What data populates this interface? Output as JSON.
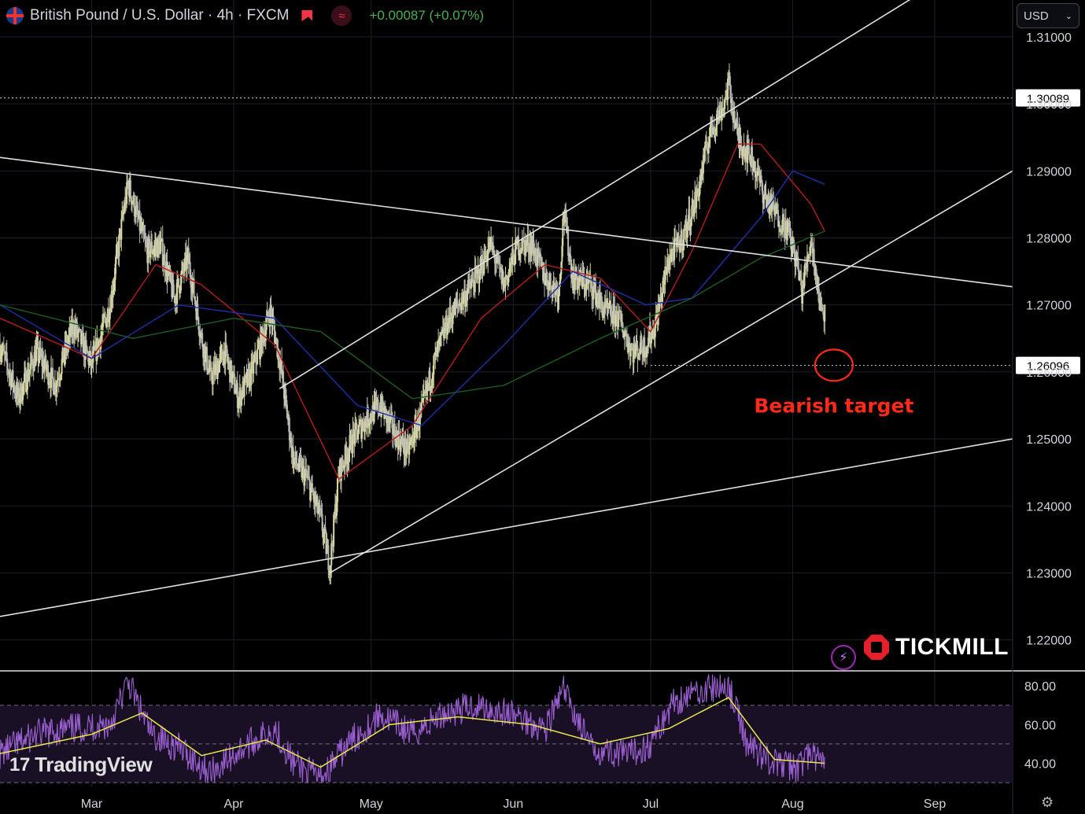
{
  "header": {
    "symbol": "British Pound / U.S. Dollar · 4h · FXCM",
    "change": "+0.00087 (+0.07%)"
  },
  "currency_selector": {
    "label": "USD"
  },
  "branding": {
    "tradingview": "TradingView",
    "tickmill": "TICKMILL"
  },
  "colors": {
    "background": "#000000",
    "candle_up": "#d8d8a0",
    "candle_down": "#b8b8b8",
    "ema_fast": "#b71c1c",
    "ema_mid": "#1e2fa8",
    "ema_slow": "#1b5e20",
    "trendline": "#e0e0e0",
    "rsi": "#9a5fd0",
    "rsi_ma": "#e8e84a",
    "annotation": "#ff2a1a",
    "change_positive": "#4caf50"
  },
  "chart_data": {
    "type": "candlestick",
    "instrument": "GBPUSD",
    "timeframe": "4h",
    "x_axis": {
      "range": [
        "2024-02-10",
        "2024-09-18"
      ],
      "ticks": [
        {
          "date": "2024-03-01",
          "label": "Mar"
        },
        {
          "date": "2024-04-01",
          "label": "Apr"
        },
        {
          "date": "2024-05-01",
          "label": "May"
        },
        {
          "date": "2024-06-01",
          "label": "Jun"
        },
        {
          "date": "2024-07-01",
          "label": "Jul"
        },
        {
          "date": "2024-08-01",
          "label": "Aug"
        },
        {
          "date": "2024-09-01",
          "label": "Sep"
        }
      ]
    },
    "y_axis": {
      "range": [
        1.2155,
        1.3155
      ],
      "ticks": [
        "1.22000",
        "1.23000",
        "1.24000",
        "1.25000",
        "1.26000",
        "1.27000",
        "1.28000",
        "1.29000",
        "1.30000",
        "1.31000"
      ]
    },
    "price_path": [
      [
        "2024-02-10",
        1.264
      ],
      [
        "2024-02-14",
        1.256
      ],
      [
        "2024-02-18",
        1.263
      ],
      [
        "2024-02-22",
        1.258
      ],
      [
        "2024-02-26",
        1.267
      ],
      [
        "2024-03-01",
        1.261
      ],
      [
        "2024-03-05",
        1.27
      ],
      [
        "2024-03-08",
        1.284
      ],
      [
        "2024-03-09",
        1.288
      ],
      [
        "2024-03-13",
        1.278
      ],
      [
        "2024-03-16",
        1.279
      ],
      [
        "2024-03-19",
        1.271
      ],
      [
        "2024-03-22",
        1.277
      ],
      [
        "2024-03-25",
        1.265
      ],
      [
        "2024-03-27",
        1.259
      ],
      [
        "2024-03-30",
        1.263
      ],
      [
        "2024-04-02",
        1.256
      ],
      [
        "2024-04-05",
        1.26
      ],
      [
        "2024-04-09",
        1.269
      ],
      [
        "2024-04-11",
        1.262
      ],
      [
        "2024-04-14",
        1.247
      ],
      [
        "2024-04-17",
        1.244
      ],
      [
        "2024-04-20",
        1.238
      ],
      [
        "2024-04-22",
        1.231
      ],
      [
        "2024-04-24",
        1.245
      ],
      [
        "2024-04-27",
        1.25
      ],
      [
        "2024-04-30",
        1.253
      ],
      [
        "2024-05-03",
        1.255
      ],
      [
        "2024-05-06",
        1.251
      ],
      [
        "2024-05-09",
        1.248
      ],
      [
        "2024-05-12",
        1.254
      ],
      [
        "2024-05-15",
        1.262
      ],
      [
        "2024-05-18",
        1.268
      ],
      [
        "2024-05-21",
        1.271
      ],
      [
        "2024-05-24",
        1.274
      ],
      [
        "2024-05-27",
        1.279
      ],
      [
        "2024-05-30",
        1.273
      ],
      [
        "2024-06-02",
        1.279
      ],
      [
        "2024-06-05",
        1.279
      ],
      [
        "2024-06-08",
        1.274
      ],
      [
        "2024-06-11",
        1.272
      ],
      [
        "2024-06-12",
        1.284
      ],
      [
        "2024-06-14",
        1.274
      ],
      [
        "2024-06-18",
        1.273
      ],
      [
        "2024-06-21",
        1.269
      ],
      [
        "2024-06-24",
        1.268
      ],
      [
        "2024-06-27",
        1.263
      ],
      [
        "2024-06-30",
        1.264
      ],
      [
        "2024-07-02",
        1.267
      ],
      [
        "2024-07-05",
        1.277
      ],
      [
        "2024-07-08",
        1.28
      ],
      [
        "2024-07-11",
        1.286
      ],
      [
        "2024-07-14",
        1.296
      ],
      [
        "2024-07-17",
        1.3
      ],
      [
        "2024-07-18",
        1.303
      ],
      [
        "2024-07-20",
        1.295
      ],
      [
        "2024-07-23",
        1.292
      ],
      [
        "2024-07-26",
        1.286
      ],
      [
        "2024-07-29",
        1.283
      ],
      [
        "2024-07-31",
        1.281
      ],
      [
        "2024-08-02",
        1.276
      ],
      [
        "2024-08-03",
        1.272
      ],
      [
        "2024-08-05",
        1.28
      ],
      [
        "2024-08-06",
        1.275
      ],
      [
        "2024-08-07",
        1.27
      ],
      [
        "2024-08-08",
        1.269
      ]
    ],
    "moving_averages": [
      {
        "color_key": "ema_fast",
        "path": [
          [
            "2024-02-10",
            1.268
          ],
          [
            "2024-03-01",
            1.262
          ],
          [
            "2024-03-15",
            1.276
          ],
          [
            "2024-03-25",
            1.273
          ],
          [
            "2024-04-10",
            1.264
          ],
          [
            "2024-04-24",
            1.244
          ],
          [
            "2024-05-10",
            1.252
          ],
          [
            "2024-05-25",
            1.268
          ],
          [
            "2024-06-08",
            1.276
          ],
          [
            "2024-06-20",
            1.274
          ],
          [
            "2024-07-01",
            1.266
          ],
          [
            "2024-07-10",
            1.278
          ],
          [
            "2024-07-20",
            1.294
          ],
          [
            "2024-07-25",
            1.294
          ],
          [
            "2024-08-05",
            1.285
          ],
          [
            "2024-08-08",
            1.281
          ]
        ]
      },
      {
        "color_key": "ema_mid",
        "path": [
          [
            "2024-02-10",
            1.27
          ],
          [
            "2024-03-01",
            1.262
          ],
          [
            "2024-03-20",
            1.27
          ],
          [
            "2024-04-10",
            1.268
          ],
          [
            "2024-04-28",
            1.255
          ],
          [
            "2024-05-12",
            1.252
          ],
          [
            "2024-05-30",
            1.264
          ],
          [
            "2024-06-14",
            1.275
          ],
          [
            "2024-06-30",
            1.27
          ],
          [
            "2024-07-10",
            1.271
          ],
          [
            "2024-07-25",
            1.283
          ],
          [
            "2024-08-01",
            1.29
          ],
          [
            "2024-08-08",
            1.288
          ]
        ]
      },
      {
        "color_key": "ema_slow",
        "path": [
          [
            "2024-02-10",
            1.27
          ],
          [
            "2024-03-10",
            1.265
          ],
          [
            "2024-04-01",
            1.268
          ],
          [
            "2024-04-20",
            1.266
          ],
          [
            "2024-05-10",
            1.256
          ],
          [
            "2024-05-30",
            1.258
          ],
          [
            "2024-06-20",
            1.265
          ],
          [
            "2024-07-10",
            1.271
          ],
          [
            "2024-07-25",
            1.277
          ],
          [
            "2024-08-08",
            1.281
          ]
        ]
      }
    ],
    "trendlines": [
      {
        "from": [
          "2024-02-10",
          1.2235
        ],
        "to": [
          "2024-09-18",
          1.25
        ]
      },
      {
        "from": [
          "2024-02-10",
          1.292
        ],
        "to": [
          "2024-09-18",
          1.2727
        ]
      },
      {
        "from": [
          "2024-04-22",
          1.23
        ],
        "to": [
          "2024-09-18",
          1.29
        ]
      },
      {
        "from": [
          "2024-04-11",
          1.2575
        ],
        "to": [
          "2024-08-30",
          1.317
        ]
      }
    ],
    "price_levels": [
      {
        "value": "1.30089"
      },
      {
        "value": "1.26096"
      }
    ],
    "annotations": [
      {
        "text": "Bearish target",
        "date": "2024-08-10",
        "price": 1.261
      }
    ],
    "rsi": {
      "range": [
        28,
        87
      ],
      "ticks": [
        "40.00",
        "60.00",
        "80.00"
      ],
      "bands": [
        30,
        50,
        70
      ],
      "path": [
        [
          "2024-02-10",
          45
        ],
        [
          "2024-02-18",
          55
        ],
        [
          "2024-02-26",
          58
        ],
        [
          "2024-03-05",
          60
        ],
        [
          "2024-03-09",
          82
        ],
        [
          "2024-03-14",
          55
        ],
        [
          "2024-03-20",
          48
        ],
        [
          "2024-03-27",
          35
        ],
        [
          "2024-04-03",
          48
        ],
        [
          "2024-04-10",
          58
        ],
        [
          "2024-04-14",
          40
        ],
        [
          "2024-04-20",
          32
        ],
        [
          "2024-04-26",
          50
        ],
        [
          "2024-05-03",
          65
        ],
        [
          "2024-05-10",
          55
        ],
        [
          "2024-05-17",
          66
        ],
        [
          "2024-05-24",
          70
        ],
        [
          "2024-06-01",
          65
        ],
        [
          "2024-06-08",
          58
        ],
        [
          "2024-06-12",
          78
        ],
        [
          "2024-06-18",
          48
        ],
        [
          "2024-06-26",
          44
        ],
        [
          "2024-07-01",
          50
        ],
        [
          "2024-07-06",
          72
        ],
        [
          "2024-07-12",
          78
        ],
        [
          "2024-07-18",
          80
        ],
        [
          "2024-07-22",
          50
        ],
        [
          "2024-07-28",
          40
        ],
        [
          "2024-08-02",
          38
        ],
        [
          "2024-08-05",
          45
        ],
        [
          "2024-08-08",
          38
        ]
      ],
      "ma_path": [
        [
          "2024-02-10",
          45
        ],
        [
          "2024-03-01",
          55
        ],
        [
          "2024-03-12",
          66
        ],
        [
          "2024-03-25",
          44
        ],
        [
          "2024-04-08",
          52
        ],
        [
          "2024-04-20",
          38
        ],
        [
          "2024-05-05",
          60
        ],
        [
          "2024-05-20",
          64
        ],
        [
          "2024-06-05",
          60
        ],
        [
          "2024-06-20",
          50
        ],
        [
          "2024-07-05",
          58
        ],
        [
          "2024-07-18",
          74
        ],
        [
          "2024-07-28",
          42
        ],
        [
          "2024-08-08",
          40
        ]
      ]
    }
  }
}
